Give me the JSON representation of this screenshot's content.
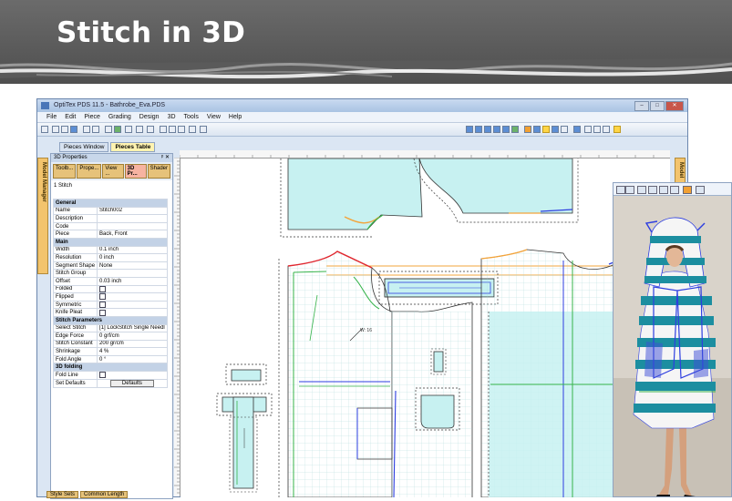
{
  "slide": {
    "title": "Stitch in 3D"
  },
  "window": {
    "title": "OptiTex PDS 11.5 - Bathrobe_Eva.PDS",
    "minimize": "–",
    "maximize": "□",
    "close": "✕"
  },
  "menu": [
    "File",
    "Edit",
    "Piece",
    "Grading",
    "Design",
    "3D",
    "Tools",
    "View",
    "Help"
  ],
  "doc_tabs": [
    "Pieces Window",
    "Pieces Table"
  ],
  "side_tabs": {
    "model_manager": "Model Manager",
    "right": "Model"
  },
  "properties": {
    "title": "3D Properties",
    "pin": "ᵖ ✕",
    "tabs": [
      "Toolb...",
      "Prope...",
      "View ...",
      "3D Pr...",
      "Shader"
    ],
    "info": "1 Stitch",
    "rows": [
      {
        "type": "section",
        "label": "General"
      },
      {
        "key": "Name",
        "value": "Stitch002"
      },
      {
        "key": "Description",
        "value": ""
      },
      {
        "key": "Code",
        "value": ""
      },
      {
        "key": "Piece",
        "value": "Back, Front"
      },
      {
        "type": "section",
        "label": "Main"
      },
      {
        "key": "Width",
        "value": "0.1 inch"
      },
      {
        "key": "Resolution",
        "value": "0 inch"
      },
      {
        "key": "Segment Shape",
        "value": "None"
      },
      {
        "key": "Stitch Group",
        "value": ""
      },
      {
        "key": "Offset",
        "value": "0.03 inch"
      },
      {
        "key": "Folded",
        "value": "",
        "check": true
      },
      {
        "key": "Flipped",
        "value": "",
        "check": true
      },
      {
        "key": "Symmetric",
        "value": "",
        "check": true
      },
      {
        "key": "Knife Pleat",
        "value": "",
        "check": true
      },
      {
        "type": "section",
        "label": "Stitch Parameters"
      },
      {
        "key": "Select Stitch",
        "value": "[1] LockStitch Single Needl"
      },
      {
        "key": "Edge Force",
        "value": "0 grf/cm"
      },
      {
        "key": "Stitch Constant",
        "value": "200 gr/cm"
      },
      {
        "key": "Shrinkage",
        "value": "4 %"
      },
      {
        "key": "Fold Angle",
        "value": "0 °"
      },
      {
        "type": "section",
        "label": "3D folding"
      },
      {
        "key": "Fold Line",
        "value": "",
        "check": true
      },
      {
        "key": "Set Defaults",
        "value": "Defaults",
        "button": true
      }
    ],
    "bottom_tabs": [
      "Style Sets",
      "Common Length"
    ]
  },
  "canvas": {
    "label": "W: 16"
  },
  "colors": {
    "piece_fill": "#c7f1f1",
    "seam_red": "#e0262e",
    "seam_orange": "#f3a43b",
    "seam_green": "#35b34a",
    "seam_blue": "#2d3ee0"
  },
  "icons": [
    "new-icon",
    "open-icon",
    "save-icon",
    "print-icon",
    "undo-icon",
    "redo-icon",
    "cut-icon",
    "copy-icon",
    "paste-icon",
    "help-icon"
  ]
}
